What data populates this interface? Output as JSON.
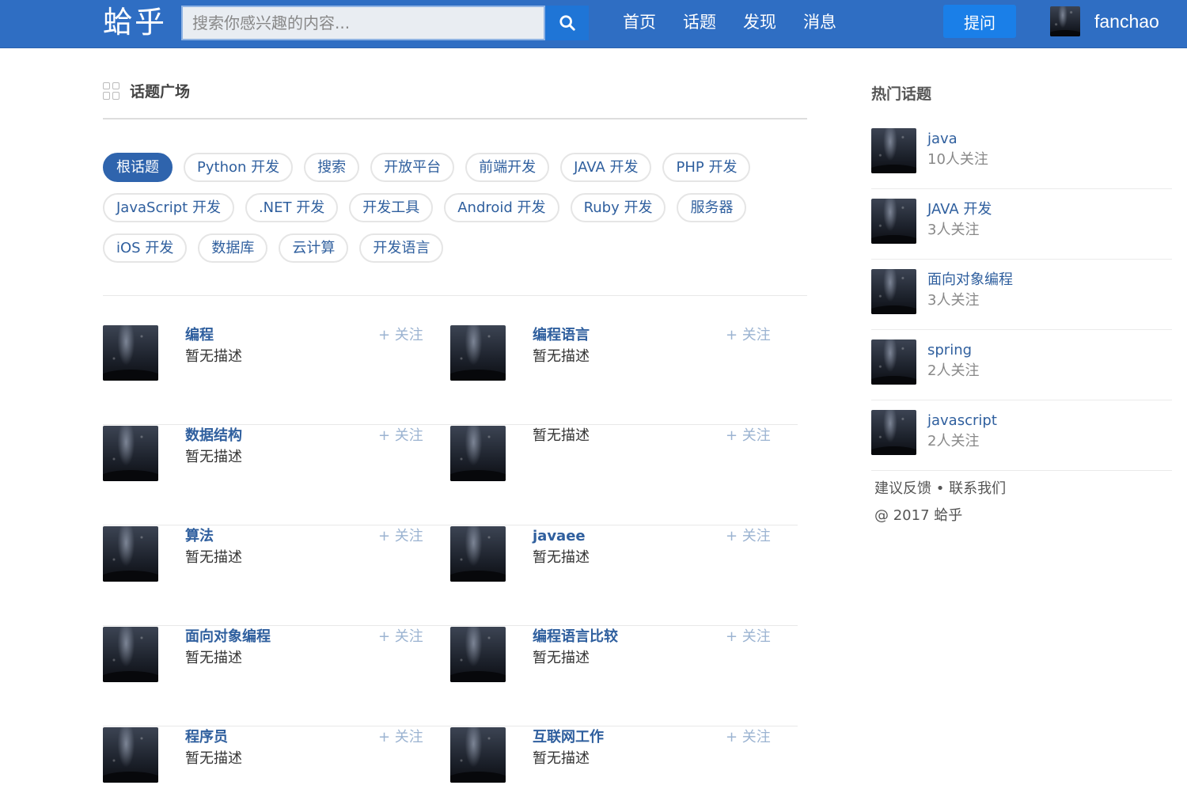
{
  "header": {
    "logo": "蛤乎",
    "search_placeholder": "搜索你感兴趣的内容...",
    "nav": [
      "首页",
      "话题",
      "发现",
      "消息"
    ],
    "ask_label": "提问",
    "username": "fanchao",
    "colors": {
      "bar": "#2f6ec3",
      "search_button": "#1f75d6",
      "ask_button": "#1a7fe8"
    },
    "icons": {
      "search": "search-icon",
      "avatar": "user-avatar"
    }
  },
  "main": {
    "title": "话题广场",
    "title_icon": "grid-icon",
    "tags": [
      "根话题",
      "Python 开发",
      "搜索",
      "开放平台",
      "前端开发",
      "JAVA 开发",
      "PHP 开发",
      "JavaScript 开发",
      ".NET 开发",
      "开发工具",
      "Android 开发",
      "Ruby 开发",
      "服务器",
      "iOS 开发",
      "数据库",
      "云计算",
      "开发语言"
    ],
    "active_tag": "根话题",
    "follow_label": "+ 关注",
    "topics": [
      {
        "name": "编程",
        "desc": "暂无描述"
      },
      {
        "name": "编程语言",
        "desc": "暂无描述"
      },
      {
        "name": "数据结构",
        "desc": "暂无描述"
      },
      {
        "name": "",
        "desc": "暂无描述"
      },
      {
        "name": "算法",
        "desc": "暂无描述"
      },
      {
        "name": "javaee",
        "desc": "暂无描述"
      },
      {
        "name": "面向对象编程",
        "desc": "暂无描述"
      },
      {
        "name": "编程语言比较",
        "desc": "暂无描述"
      },
      {
        "name": "程序员",
        "desc": "暂无描述"
      },
      {
        "name": "互联网工作",
        "desc": "暂无描述"
      }
    ]
  },
  "sidebar": {
    "title": "热门话题",
    "hot_topics": [
      {
        "name": "java",
        "followers": "10人关注"
      },
      {
        "name": "JAVA 开发",
        "followers": "3人关注"
      },
      {
        "name": "面向对象编程",
        "followers": "3人关注"
      },
      {
        "name": "spring",
        "followers": "2人关注"
      },
      {
        "name": "javascript",
        "followers": "2人关注"
      }
    ],
    "feedback": "建议反馈",
    "separator": "•",
    "contact": "联系我们",
    "copyright": "@ 2017 蛤乎"
  }
}
